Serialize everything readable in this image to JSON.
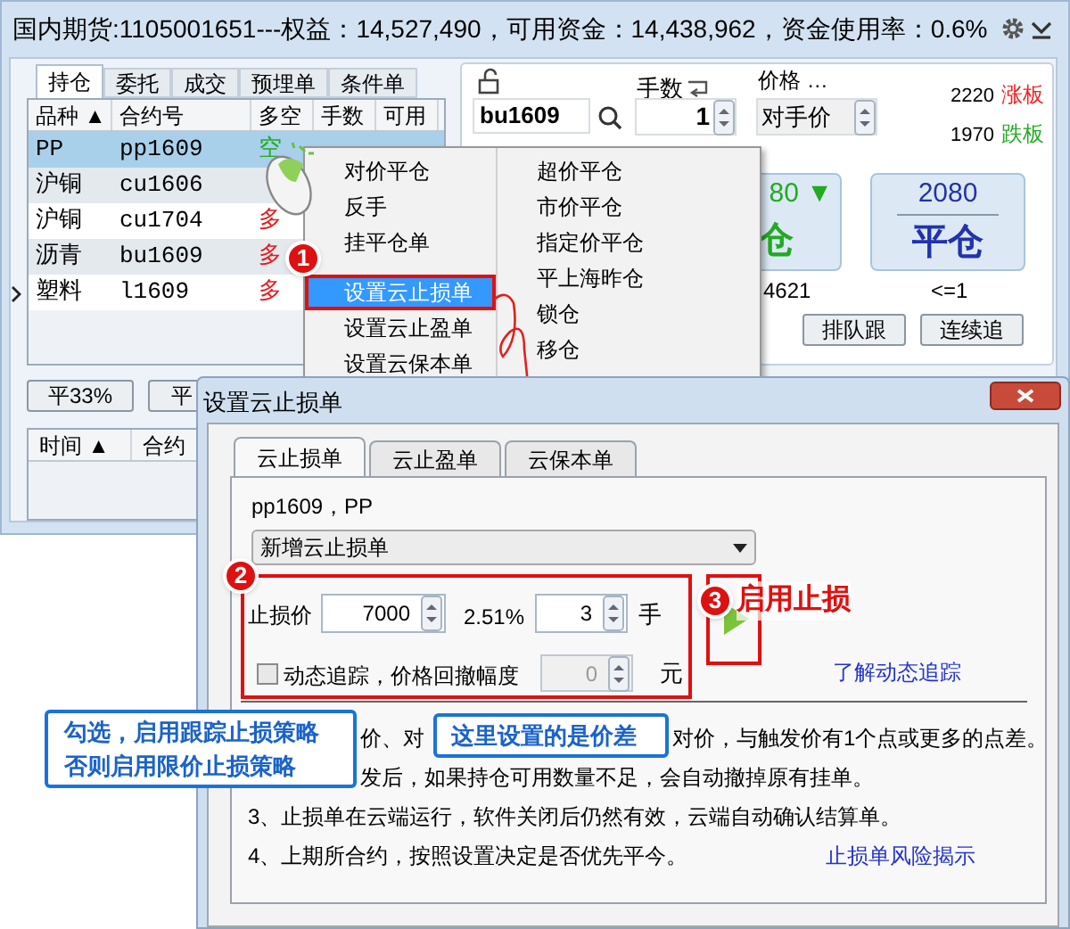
{
  "title_bar": {
    "text": "国内期货:1105001651---权益：14,527,490，可用资金：14,438,962，资金使用率：0.6%"
  },
  "position_tabs": [
    {
      "label": "持仓",
      "selected": true
    },
    {
      "label": "委托",
      "selected": false
    },
    {
      "label": "成交",
      "selected": false
    },
    {
      "label": "预埋单",
      "selected": false
    },
    {
      "label": "条件单",
      "selected": false
    }
  ],
  "positions_table": {
    "columns": [
      "品种 ▲",
      "合约号",
      "多空",
      "手数",
      "可用"
    ],
    "rows": [
      {
        "cells": [
          "PP",
          "pp1609",
          "空"
        ],
        "color": "#22aa22",
        "selected": true,
        "current": false
      },
      {
        "cells": [
          "沪铜",
          "cu1606"
        ],
        "selected": false,
        "current": false
      },
      {
        "cells": [
          "沪铜",
          "cu1704",
          "多"
        ],
        "color": "#e02020",
        "selected": false,
        "current": false
      },
      {
        "cells": [
          "沥青",
          "bu1609",
          "多"
        ],
        "color": "#e02020",
        "selected": false,
        "current": false
      },
      {
        "cells": [
          "塑料",
          "l1609",
          "多"
        ],
        "color": "#e02020",
        "selected": false,
        "current": true
      }
    ]
  },
  "order_panel": {
    "contract": "bu1609",
    "lots_label": "手数",
    "lots": "1",
    "price_label": "价格 …",
    "price_type": "对手价",
    "limit_up": "2220",
    "limit_up_label": "涨板",
    "limit_down": "1970",
    "limit_down_label": "跌板",
    "open_button": {
      "price": "80 ▼",
      "label": "仓"
    },
    "close_button": {
      "price": "2080",
      "label": "平仓"
    },
    "open_note": "4621",
    "close_note": "<=1",
    "buttons": [
      "排队跟",
      "连续追"
    ]
  },
  "bottom_buttons": [
    "平33%",
    "平"
  ],
  "orders_table": {
    "columns": [
      "时间 ▲",
      "合约"
    ]
  },
  "context_menu": {
    "left": [
      {
        "kind": "item",
        "label": "对价平仓",
        "selected": false
      },
      {
        "kind": "item",
        "label": "反手",
        "selected": false
      },
      {
        "kind": "item",
        "label": "挂平仓单",
        "selected": false
      },
      {
        "kind": "separator"
      },
      {
        "kind": "item",
        "label": "设置云止损单",
        "selected": true
      },
      {
        "kind": "item",
        "label": "设置云止盈单",
        "selected": false
      },
      {
        "kind": "item",
        "label": "设置云保本单",
        "selected": false
      }
    ],
    "right": [
      "超价平仓",
      "市价平仓",
      "指定价平仓",
      "平上海昨仓",
      "锁仓",
      "移仓"
    ]
  },
  "dialog": {
    "title": "设置云止损单",
    "tabs": [
      {
        "label": "云止损单",
        "selected": true
      },
      {
        "label": "云止盈单",
        "selected": false
      },
      {
        "label": "云保本单",
        "selected": false
      }
    ],
    "contract_line": "pp1609，PP",
    "dropdown": "新增云止损单",
    "stop_price_label": "止损价",
    "stop_price": "7000",
    "percent": "2.51%",
    "lots": "3",
    "lots_unit": "手",
    "trailing": {
      "label": "动态追踪，价格回撤幅度",
      "checked": false
    },
    "pullback": {
      "value": "0",
      "disabled": true
    },
    "pullback_unit": "元",
    "trailing_link": "了解动态追踪",
    "notes": [
      [
        "价、对",
        "对价，与触发价有1个点或更多的点差。"
      ],
      [
        "发后，如果持仓可用数量不足，会自动撤掉原有挂单。"
      ],
      [
        "3、止损单在云端运行，软件关闭后仍然有效，云端自动确认结算单。"
      ],
      [
        "4、上期所合约，按照设置决定是否优先平今。"
      ]
    ],
    "risk_link": "止损单风险揭示"
  },
  "annotations": {
    "badges": [
      "1",
      "2",
      "3"
    ],
    "start_label": "启用止损",
    "callouts": [
      {
        "lines": [
          "勾选，启用跟踪止损策略",
          "否则启用限价止损策略"
        ]
      },
      {
        "lines": [
          "这里设置的是价差"
        ]
      }
    ]
  }
}
